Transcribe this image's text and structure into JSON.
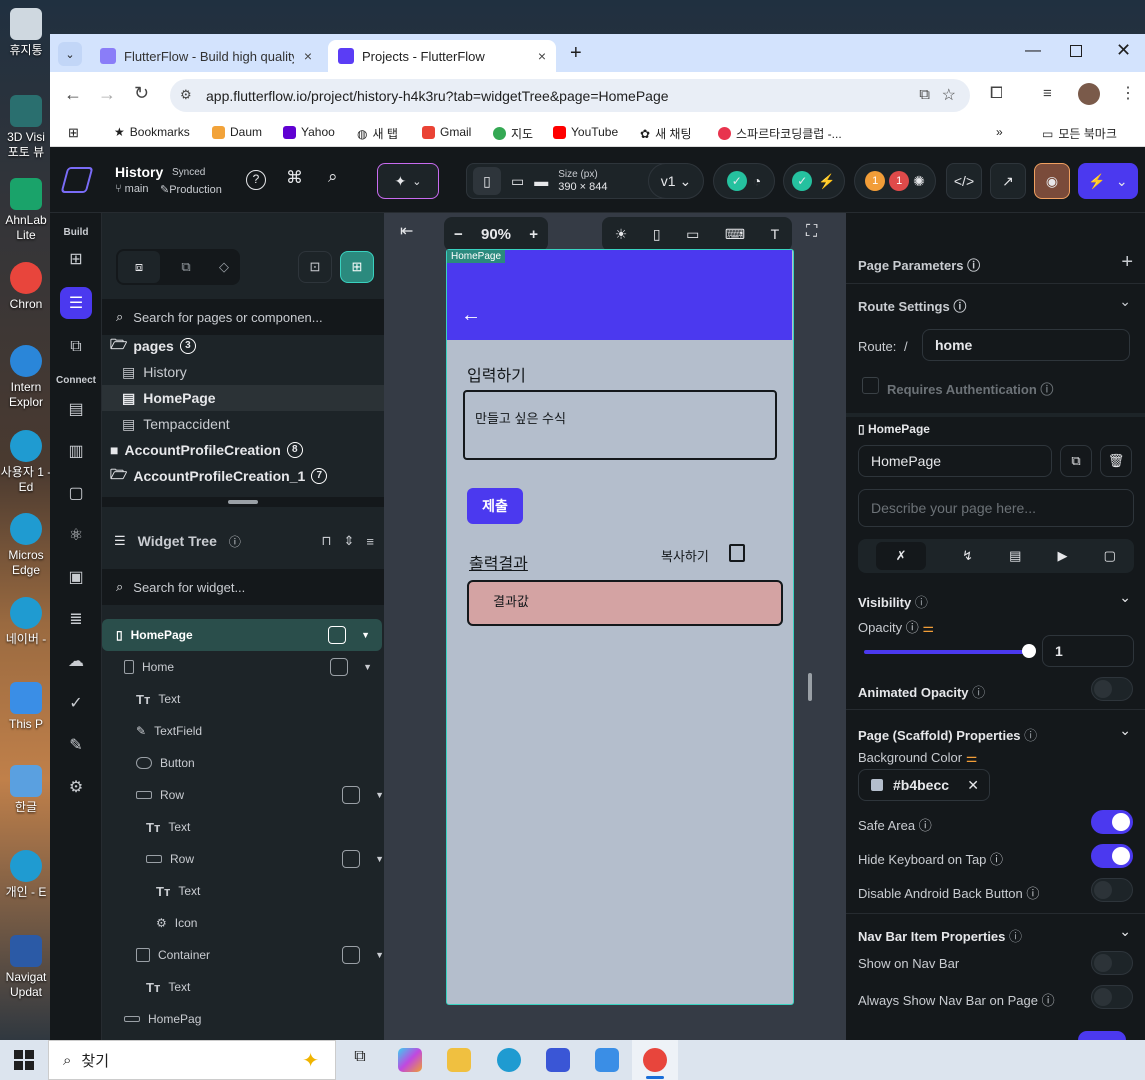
{
  "desktop": {
    "icons": [
      "휴지통",
      "3D Visi 포토 뷰",
      "AhnLab Lite",
      "Chron",
      "Intern Explor",
      "사용자 1 - Ed",
      "Micros Edge",
      "네이버 -",
      "This P",
      "한글",
      "개인 - E",
      "Navigat Updat"
    ]
  },
  "browser": {
    "tabs": [
      {
        "label": "FlutterFlow - Build high quality"
      },
      {
        "label": "Projects - FlutterFlow"
      }
    ],
    "new_tab": "+",
    "url": "app.flutterflow.io/project/history-h4k3ru?tab=widgetTree&page=HomePage",
    "bookmarks": [
      "Bookmarks",
      "Daum",
      "Yahoo",
      "새 탭",
      "Gmail",
      "지도",
      "YouTube",
      "새 채팅",
      "스파르타코딩클럽 -..."
    ],
    "all_bookmarks": "모든 북마크",
    "more": "»"
  },
  "app": {
    "project": {
      "name": "History",
      "status": "Synced",
      "branch": "main",
      "env": "Production"
    },
    "device_size_label": "Size (px)",
    "device_size": "390 × 844",
    "version": "v1",
    "badges": [
      "1",
      "1"
    ],
    "rail_labels": {
      "build": "Build",
      "connect": "Connect"
    },
    "pages_search_placeholder": "Search for pages or componen...",
    "pages_folder": "pages",
    "pages_count": "3",
    "pages": [
      "History",
      "HomePage",
      "Tempaccident"
    ],
    "folders": [
      {
        "name": "AccountProfileCreation",
        "count": "8"
      },
      {
        "name": "AccountProfileCreation_1",
        "count": "7"
      }
    ],
    "widget_tree_title": "Widget Tree",
    "widget_search_placeholder": "Search for widget...",
    "tree": [
      "HomePage",
      "Home",
      "Text",
      "TextField",
      "Button",
      "Row",
      "Text",
      "Row",
      "Text",
      "Icon",
      "Container",
      "Text",
      "HomePag"
    ],
    "zoom": "90%",
    "phone": {
      "page_tag": "HomePage",
      "back_arrow": "←",
      "input_label": "입력하기",
      "input_placeholder": "만들고 싶은 수식",
      "submit": "제출",
      "output_label": "출력결과",
      "copy": "복사하기",
      "result": "결과값",
      "appbar_color": "#4b39ef",
      "bg_color": "#b4becc",
      "result_color": "#d4a3a3"
    },
    "right": {
      "page_parameters": "Page Parameters",
      "route_settings": "Route Settings",
      "route_label": "Route:",
      "route_slash": "/",
      "route_value": "home",
      "requires_auth": "Requires Authentication",
      "page_name_header": "HomePage",
      "page_name_value": "HomePage",
      "describe_placeholder": "Describe your page here...",
      "visibility": "Visibility",
      "opacity": "Opacity",
      "opacity_value": "1",
      "animated_opacity": "Animated Opacity",
      "scaffold_props": "Page (Scaffold) Properties",
      "bg_color_label": "Background Color",
      "bg_color_value": "#b4becc",
      "safe_area": "Safe Area",
      "hide_keyboard": "Hide Keyboard on Tap",
      "disable_back": "Disable Android Back Button",
      "nav_bar_props": "Nav Bar Item Properties",
      "show_nav_bar": "Show on Nav Bar",
      "always_show_nav": "Always Show Nav Bar on Page"
    },
    "accent": "#4b39ef"
  },
  "taskbar": {
    "search_placeholder": "찾기"
  }
}
